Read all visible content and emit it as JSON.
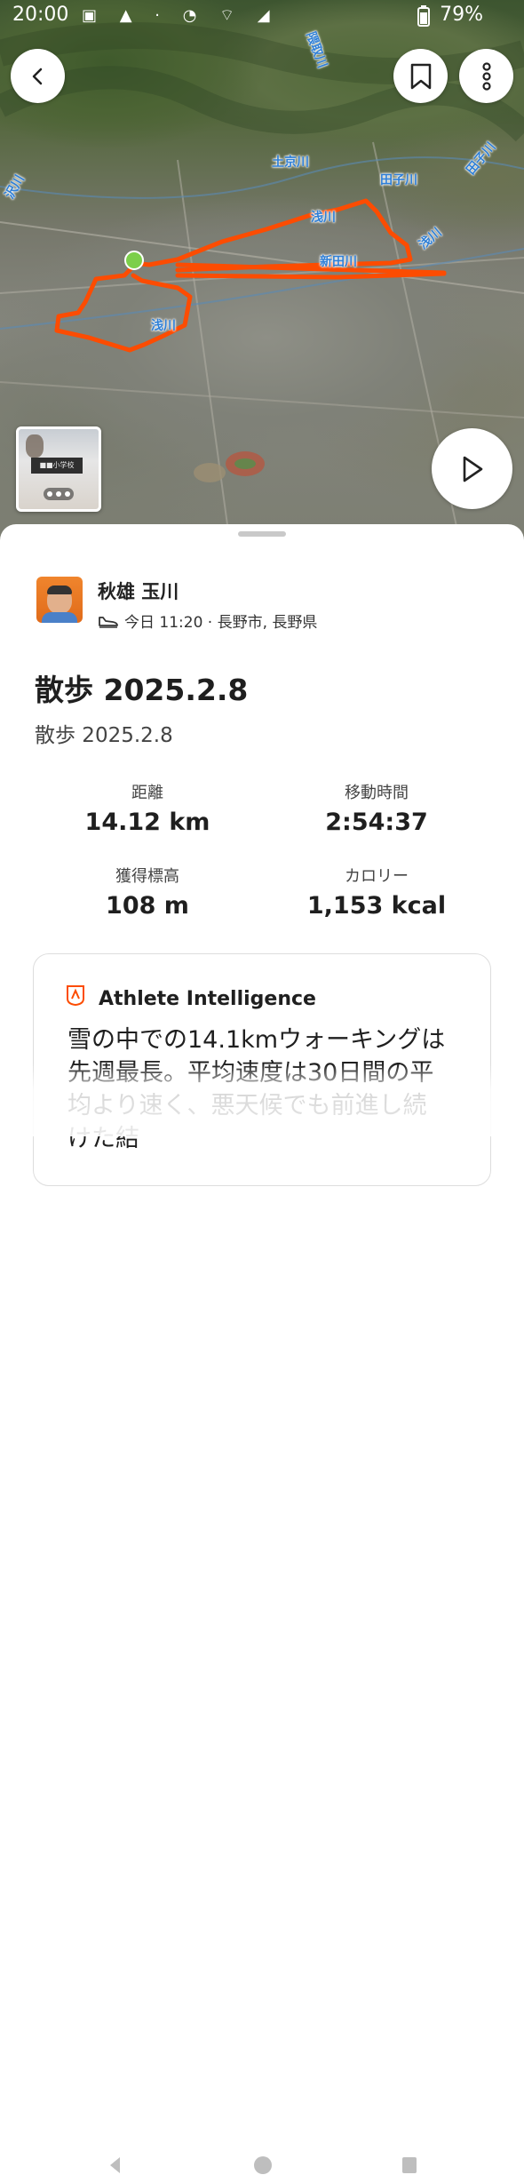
{
  "status_bar": {
    "time": "20:00",
    "battery": "79%"
  },
  "map": {
    "river_labels": [
      "隈取川",
      "土京川",
      "田子川",
      "田子川",
      "浅川",
      "浅川",
      "新田川",
      "浅川",
      "沢川"
    ]
  },
  "activity": {
    "athlete_name": "秋雄 玉川",
    "meta": "今日 11:20 · 長野市, 長野県",
    "title": "散歩 2025.2.8",
    "description": "散歩 2025.2.8"
  },
  "stats": {
    "distance": {
      "label": "距離",
      "value": "14.12 km"
    },
    "moving_time": {
      "label": "移動時間",
      "value": "2:54:37"
    },
    "elevation": {
      "label": "獲得標高",
      "value": "108 m"
    },
    "calories": {
      "label": "カロリー",
      "value": "1,153 kcal"
    }
  },
  "athlete_intelligence": {
    "title": "Athlete Intelligence",
    "body": "雪の中での14.1kmウォーキングは先週最長。平均速度は30日間の平均より速く、悪天候でも前進し続けた結"
  },
  "colors": {
    "route": "#fc4c02",
    "start_marker": "#7ccf4a",
    "river_text": "#2f7fd6"
  }
}
